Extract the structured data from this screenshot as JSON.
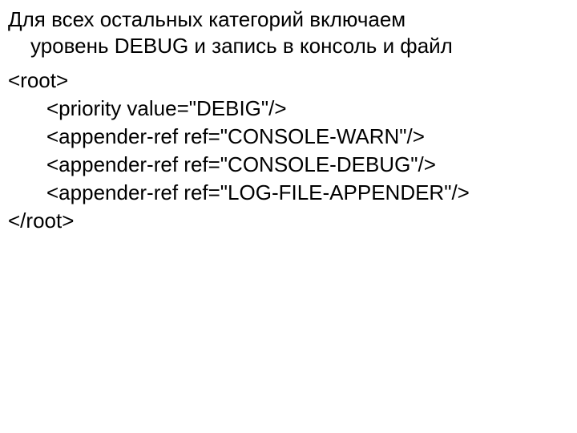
{
  "heading": {
    "line1": "Для всех остальных категорий включаем",
    "line2": "уровень DEBUG и запись в консоль и файл"
  },
  "code": {
    "open": "<root>",
    "l1": "<priority value=\"DEBIG\"/>",
    "l2": "<appender-ref ref=\"CONSOLE-WARN\"/>",
    "l3": "<appender-ref ref=\"CONSOLE-DEBUG\"/>",
    "l4": "<appender-ref ref=\"LOG-FILE-APPENDER\"/>",
    "close": "</root>"
  }
}
